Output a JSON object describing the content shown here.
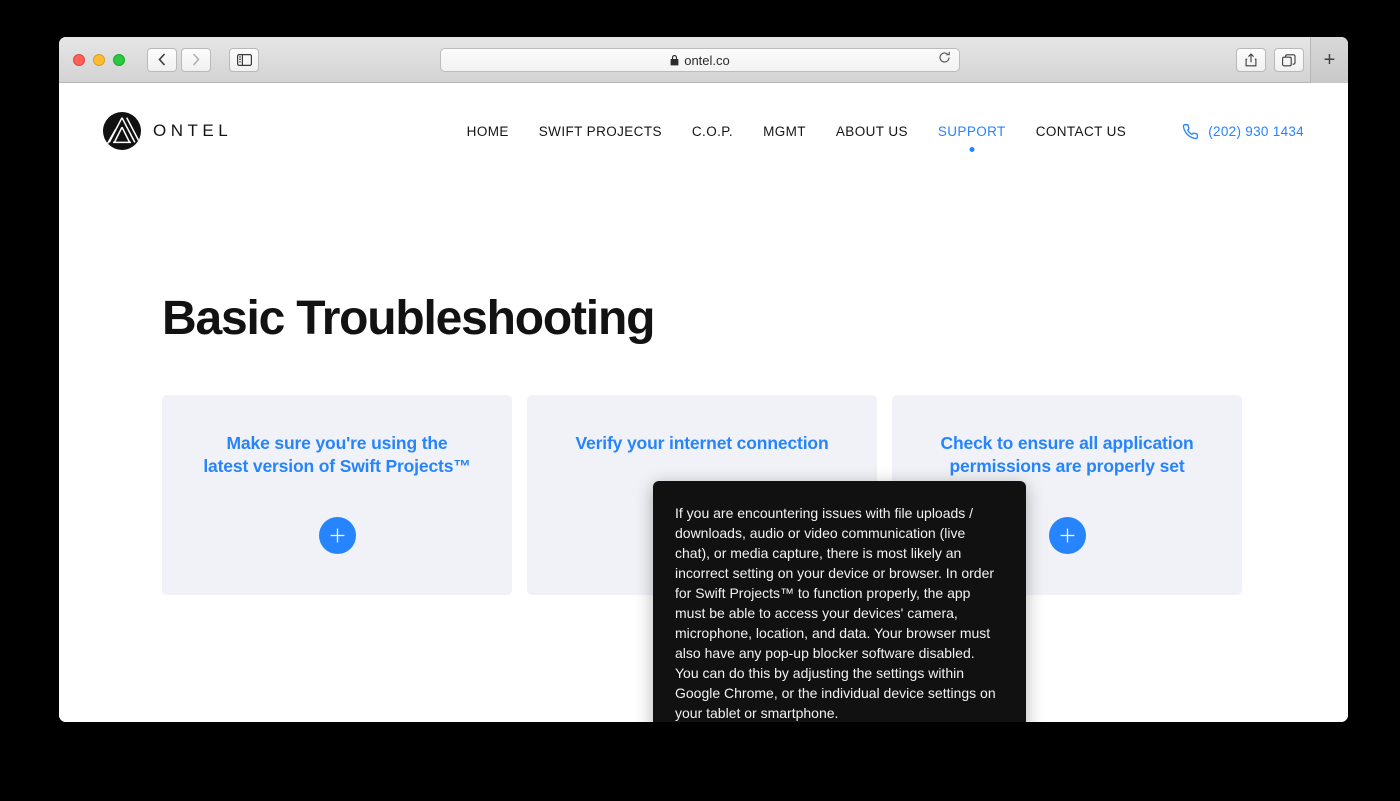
{
  "browser": {
    "url": "ontel.co",
    "lock_icon": "lock-icon",
    "reload_icon": "reload-icon",
    "back_icon": "chevron-left-icon",
    "forward_icon": "chevron-right-icon",
    "sidebar_icon": "sidebar-toggle-icon",
    "share_icon": "share-icon",
    "tabs_icon": "tab-overview-icon",
    "newtab_label": "+"
  },
  "site": {
    "brand": "ONTEL",
    "nav": [
      {
        "label": "HOME",
        "active": false
      },
      {
        "label": "SWIFT PROJECTS",
        "active": false
      },
      {
        "label": "C.O.P.",
        "active": false
      },
      {
        "label": "MGMT",
        "active": false
      },
      {
        "label": "ABOUT US",
        "active": false
      },
      {
        "label": "SUPPORT",
        "active": true
      },
      {
        "label": "CONTACT US",
        "active": false
      }
    ],
    "phone": "(202) 930 1434",
    "title": "Basic Troubleshooting",
    "cards": [
      {
        "title": "Make sure you're using the latest version of Swift Projects™",
        "button": "+"
      },
      {
        "title": "Verify your internet connection",
        "button": "+"
      },
      {
        "title": "Check to ensure all application permissions are properly set",
        "button": "+"
      }
    ]
  },
  "tooltip": {
    "text": "If you are encountering issues with file uploads / downloads, audio or video communication (live chat), or media capture, there is most likely an incorrect setting on your device or browser. In order for Swift Projects™ to function properly, the app must be able to access your devices' camera, microphone, location, and data. Your browser must also have any pop-up blocker software disabled. You can do this by adjusting the settings within Google Chrome, or the individual device settings on your tablet or smartphone."
  },
  "colors": {
    "accent": "#2684fc",
    "card_bg": "#f0f2f7",
    "tooltip_bg": "#111112",
    "heading": "#121212"
  }
}
